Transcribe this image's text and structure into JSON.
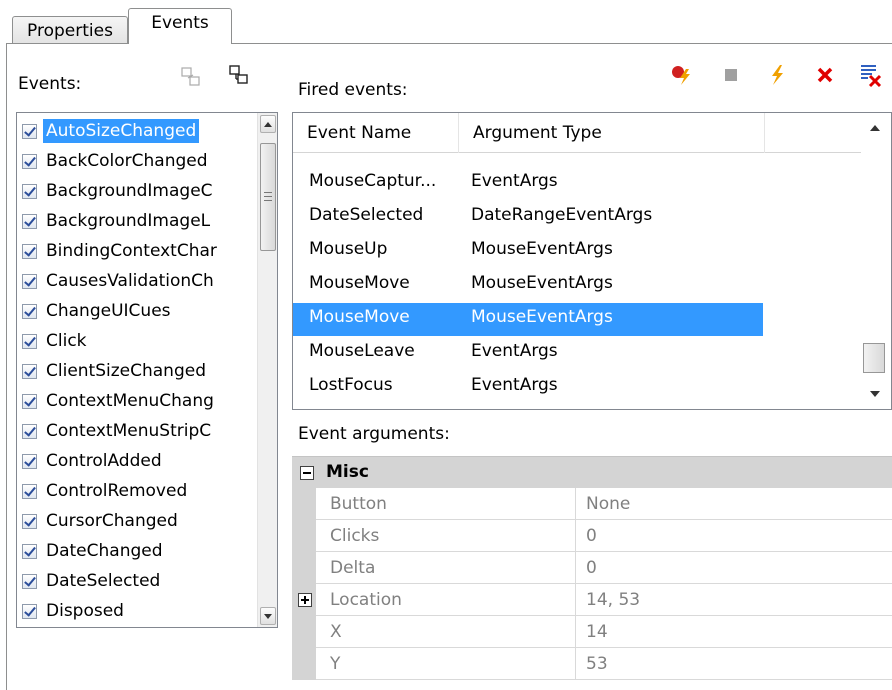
{
  "tabs": [
    {
      "label": "Properties"
    },
    {
      "label": "Events"
    }
  ],
  "left": {
    "events_label": "Events:",
    "toolbar_icons": [
      "collapse-windows-icon",
      "new-window-icon"
    ],
    "items": [
      {
        "label": "AutoSizeChanged",
        "checked": true,
        "selected": true
      },
      {
        "label": "BackColorChanged",
        "checked": true
      },
      {
        "label": "BackgroundImageC",
        "checked": true
      },
      {
        "label": "BackgroundImageL",
        "checked": true
      },
      {
        "label": "BindingContextChar",
        "checked": true
      },
      {
        "label": "CausesValidationCh",
        "checked": true
      },
      {
        "label": "ChangeUICues",
        "checked": true
      },
      {
        "label": "Click",
        "checked": true
      },
      {
        "label": "ClientSizeChanged",
        "checked": true
      },
      {
        "label": "ContextMenuChang",
        "checked": true
      },
      {
        "label": "ContextMenuStripC",
        "checked": true
      },
      {
        "label": "ControlAdded",
        "checked": true
      },
      {
        "label": "ControlRemoved",
        "checked": true
      },
      {
        "label": "CursorChanged",
        "checked": true
      },
      {
        "label": "DateChanged",
        "checked": true
      },
      {
        "label": "DateSelected",
        "checked": true
      },
      {
        "label": "Disposed",
        "checked": true
      }
    ]
  },
  "fired": {
    "label": "Fired events:",
    "toolbar_icons": [
      "start-capture-icon",
      "stop-icon",
      "lightning-icon",
      "delete-icon",
      "clear-list-icon"
    ],
    "colors": {
      "start": "#d02020",
      "stop": "#a0a0a0",
      "lightning": "#f0a000",
      "delete": "#e00000",
      "clear": "#3060c0"
    },
    "columns": [
      "Event Name",
      "Argument Type"
    ],
    "rows": [
      {
        "name": "MouseCaptur...",
        "type": "EventArgs"
      },
      {
        "name": "DateSelected",
        "type": "DateRangeEventArgs"
      },
      {
        "name": "MouseUp",
        "type": "MouseEventArgs"
      },
      {
        "name": "MouseMove",
        "type": "MouseEventArgs"
      },
      {
        "name": "MouseMove",
        "type": "MouseEventArgs",
        "selected": true
      },
      {
        "name": "MouseLeave",
        "type": "EventArgs"
      },
      {
        "name": "LostFocus",
        "type": "EventArgs"
      }
    ]
  },
  "args": {
    "label": "Event arguments:",
    "category": "Misc",
    "rows": [
      {
        "name": "Button",
        "value": "None"
      },
      {
        "name": "Clicks",
        "value": "0"
      },
      {
        "name": "Delta",
        "value": "0"
      },
      {
        "name": "Location",
        "value": "14, 53",
        "expandable": true
      },
      {
        "name": "X",
        "value": "14"
      },
      {
        "name": "Y",
        "value": "53"
      }
    ]
  },
  "colors": {
    "selection": "#3399ff",
    "category_bg": "#d4d4d4"
  }
}
